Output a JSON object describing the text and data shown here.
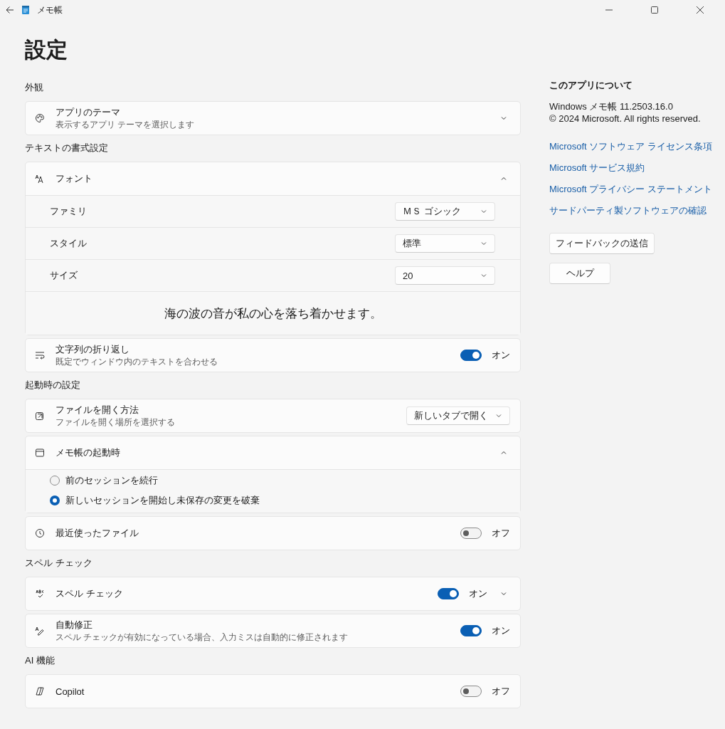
{
  "window": {
    "title": "メモ帳"
  },
  "page_title": "設定",
  "sections": [
    {
      "heading": "外観",
      "cards": [
        {
          "kind": "expander",
          "title": "アプリのテーマ",
          "subtitle": "表示するアプリ テーマを選択します",
          "expanded": false
        }
      ]
    },
    {
      "heading": "テキストの書式設定",
      "cards": [
        {
          "kind": "font",
          "title": "フォント",
          "expanded": true,
          "rows": [
            {
              "label": "ファミリ",
              "value": "ＭＳ ゴシック"
            },
            {
              "label": "スタイル",
              "value": "標準"
            },
            {
              "label": "サイズ",
              "value": "20"
            }
          ],
          "preview": "海の波の音が私の心を落ち着かせます。"
        },
        {
          "kind": "toggle",
          "title": "文字列の折り返し",
          "subtitle": "既定でウィンドウ内のテキストを合わせる",
          "on": true,
          "state_label": "オン"
        }
      ]
    },
    {
      "heading": "起動時の設定",
      "cards": [
        {
          "kind": "combo",
          "title": "ファイルを開く方法",
          "subtitle": "ファイルを開く場所を選択する",
          "value": "新しいタブで開く"
        },
        {
          "kind": "radios",
          "title": "メモ帳の起動時",
          "expanded": true,
          "options": [
            {
              "label": "前のセッションを続行",
              "selected": false
            },
            {
              "label": "新しいセッションを開始し未保存の変更を破棄",
              "selected": true
            }
          ]
        },
        {
          "kind": "toggle",
          "title": "最近使ったファイル",
          "on": false,
          "state_label": "オフ"
        }
      ]
    },
    {
      "heading": "スペル チェック",
      "cards": [
        {
          "kind": "toggle",
          "title": "スペル チェック",
          "on": true,
          "state_label": "オン",
          "expanded": false
        },
        {
          "kind": "toggle",
          "title": "自動修正",
          "subtitle": "スペル チェックが有効になっている場合、入力ミスは自動的に修正されます",
          "on": true,
          "state_label": "オン"
        }
      ]
    },
    {
      "heading": "AI 機能",
      "cards": [
        {
          "kind": "toggle",
          "title": "Copilot",
          "on": false,
          "state_label": "オフ"
        }
      ]
    }
  ],
  "about": {
    "heading": "このアプリについて",
    "version": "Windows メモ帳 11.2503.16.0",
    "copyright": "© 2024 Microsoft. All rights reserved.",
    "links": [
      "Microsoft ソフトウェア ライセンス条項",
      "Microsoft サービス規約",
      "Microsoft プライバシー ステートメント",
      "サードパーティ製ソフトウェアの確認"
    ],
    "buttons": [
      "フィードバックの送信",
      "ヘルプ"
    ]
  }
}
